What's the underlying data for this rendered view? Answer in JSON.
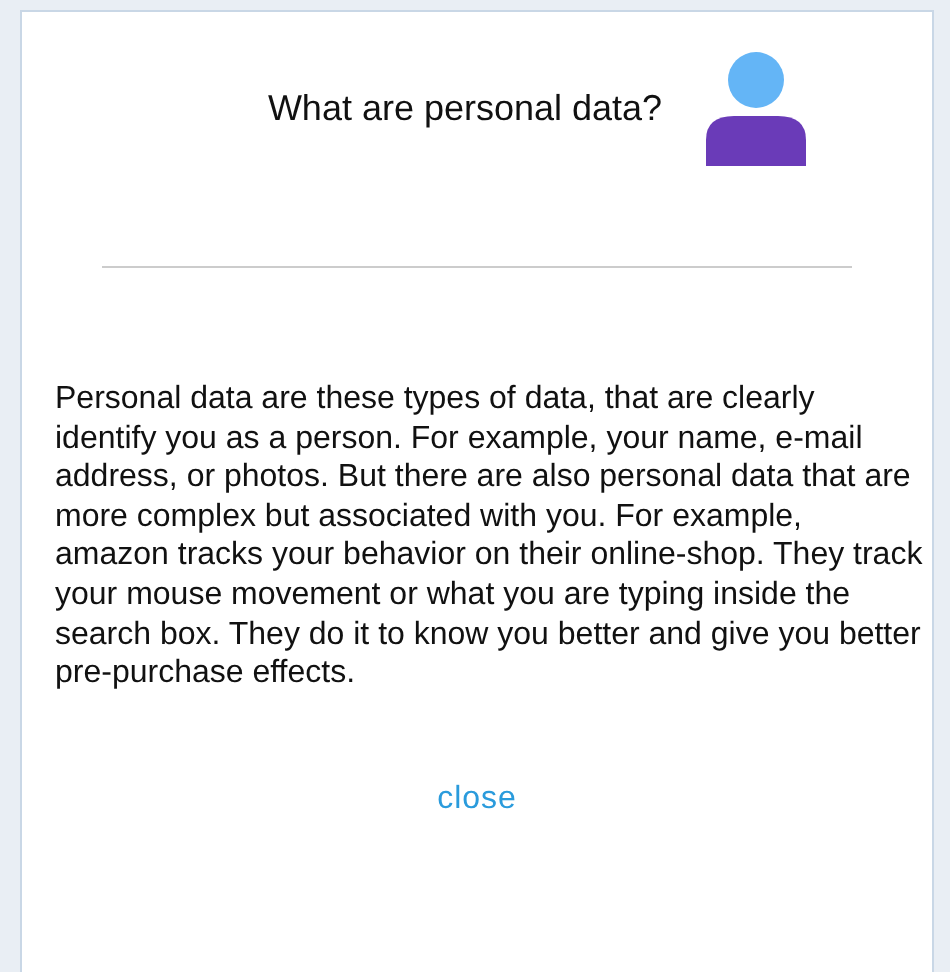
{
  "dialog": {
    "title": "What are personal data?",
    "body": "Personal data are these types of data, that are clearly identify you as a person. For example, your name, e-mail address, or photos. But there are also personal data that are more complex but associated with you. For example, amazon tracks your behavior on their online-shop. They track your mouse movement or what you are typing inside the search box. They do it to know you better and give you better pre-purchase effects.",
    "close": "close"
  }
}
